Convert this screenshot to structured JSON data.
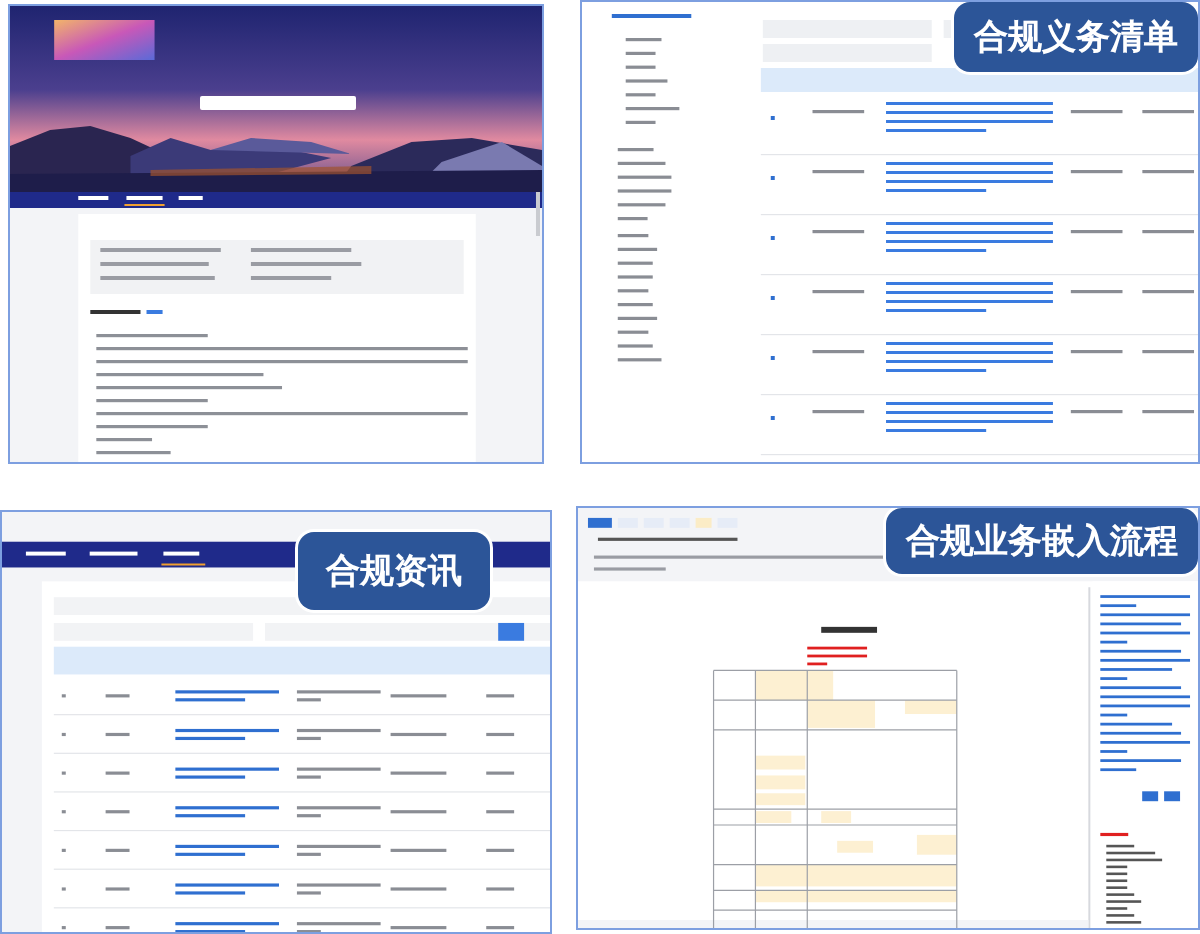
{
  "panels": [
    {
      "kind": "search_portal"
    },
    {
      "kind": "obligation_list",
      "label": "合规义务清单"
    },
    {
      "kind": "news",
      "label": "合规资讯"
    },
    {
      "kind": "workflow",
      "label": "合规业务嵌入流程"
    }
  ]
}
